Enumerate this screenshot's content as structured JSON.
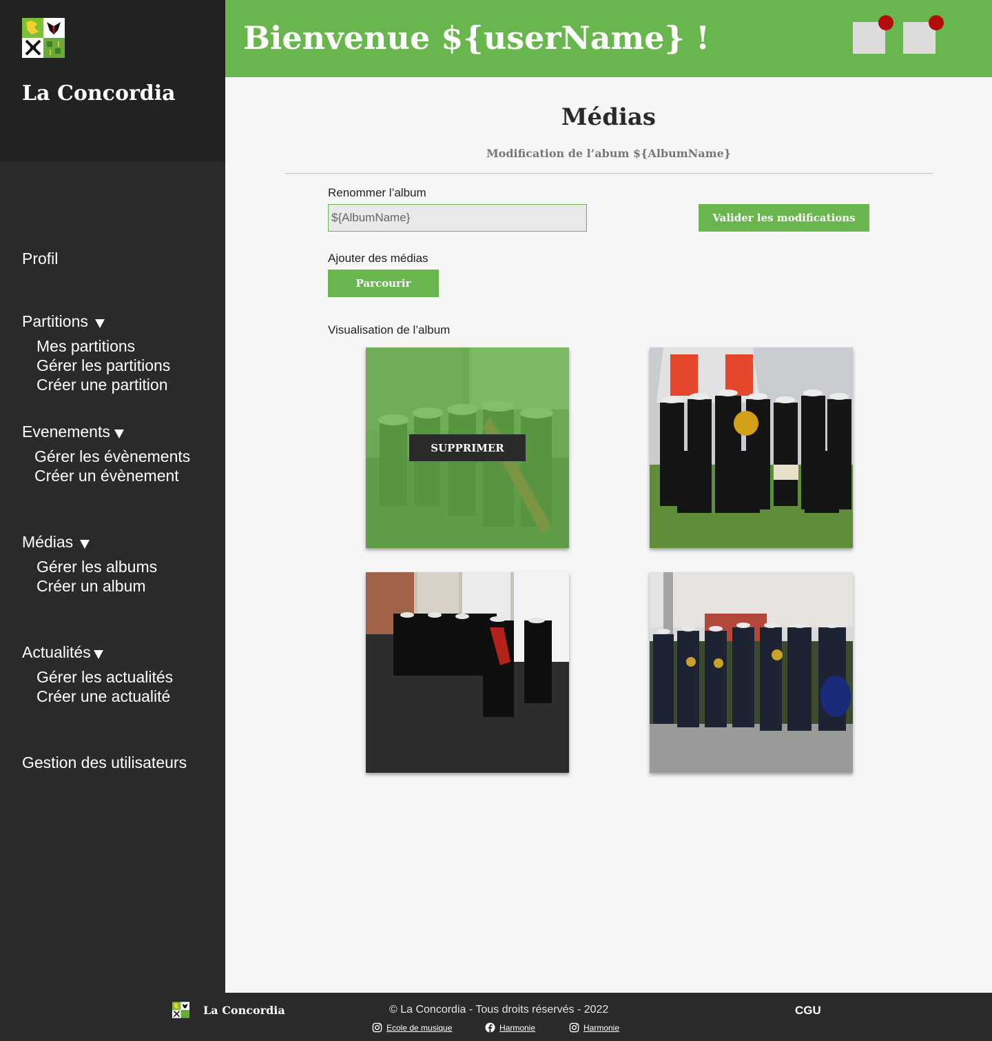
{
  "sidebar": {
    "brand": "La Concordia",
    "crest_icon": "coat-of-arms-icon",
    "menu": {
      "profil": "Profil",
      "partitions": {
        "label": "Partitions",
        "items": [
          "Mes partitions",
          "Gérer les partitions",
          "Créer une partition"
        ]
      },
      "evenements": {
        "label": "Evenements",
        "items": [
          "Gérer les évènements",
          "Créer un évènement"
        ]
      },
      "medias": {
        "label": "Médias",
        "items": [
          "Gérer les albums",
          "Créer un album"
        ]
      },
      "actualites": {
        "label": "Actualités",
        "items": [
          "Gérer les actualités",
          "Créer une actualité"
        ]
      },
      "utilisateurs": "Gestion des utilisateurs"
    }
  },
  "header": {
    "welcome": "Bienvenue ${userName} !",
    "notifications": [
      "notification-icon",
      "message-icon"
    ]
  },
  "main": {
    "title": "Médias",
    "subtitle": "Modification de l’abum ${AlbumName}",
    "rename_label": "Renommer l’album",
    "rename_value": "${AlbumName}",
    "validate_button": "Valider les modifications",
    "add_media_label": "Ajouter des médias",
    "browse_button": "Parcourir",
    "preview_label": "Visualisation de l’album",
    "delete_button": "SUPPRIMER"
  },
  "footer": {
    "brand": "La Concordia",
    "copyright": "© La Concordia - Tous droits réservés - 2022",
    "cgu": "CGU",
    "links": [
      {
        "icon": "instagram-icon",
        "label": "Ecole de musique"
      },
      {
        "icon": "facebook-icon",
        "label": "Harmonie"
      },
      {
        "icon": "instagram-icon",
        "label": "Harmonie"
      }
    ]
  },
  "colors": {
    "accent": "#6ab64e",
    "sidebar": "#2a2a2a",
    "badge": "#b30c0c",
    "background": "#f6f6f6"
  }
}
